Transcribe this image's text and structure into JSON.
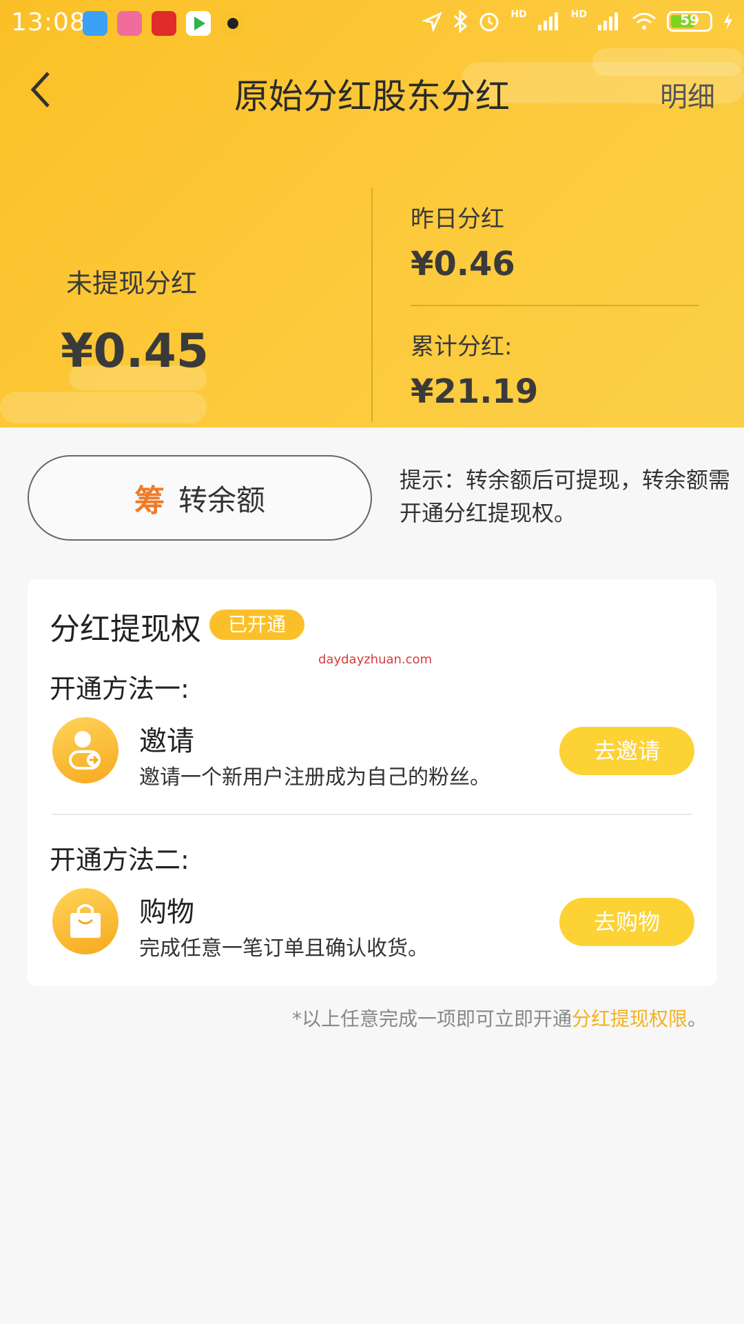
{
  "status_bar": {
    "time": "13:08",
    "battery": "59",
    "signal_1": "HD",
    "signal_2": "HD"
  },
  "nav": {
    "title": "原始分红股东分红",
    "detail_label": "明细"
  },
  "stats": {
    "unwithdrawn_label": "未提现分红",
    "unwithdrawn_value": "¥0.45",
    "yesterday_label": "昨日分红",
    "yesterday_value": "¥0.46",
    "total_label": "累计分红:",
    "total_value": "¥21.19"
  },
  "transfer": {
    "icon_glyph": "筹",
    "label": "转余额",
    "tip": "提示：转余额后可提现，转余额需开通分红提现权。"
  },
  "card": {
    "title": "分红提现权",
    "badge": "已开通",
    "watermark": "daydayzhuan.com",
    "method1": {
      "title": "开通方法一:",
      "name": "邀请",
      "desc": "邀请一个新用户注册成为自己的粉丝。",
      "button": "去邀请",
      "icon": "invite-user-icon"
    },
    "method2": {
      "title": "开通方法二:",
      "name": "购物",
      "desc": "完成任意一笔订单且确认收货。",
      "button": "去购物",
      "icon": "shopping-bag-icon"
    }
  },
  "footnote": {
    "prefix": "*以上任意完成一项即可立即开通",
    "highlight": "分红提现权限",
    "suffix": "。"
  },
  "colors": {
    "brand_yellow": "#fbc027",
    "button_yellow": "#fcd235",
    "badge_yellow": "#fbc029",
    "highlight": "#f3b11e",
    "transfer_icon": "#f07a2a"
  }
}
